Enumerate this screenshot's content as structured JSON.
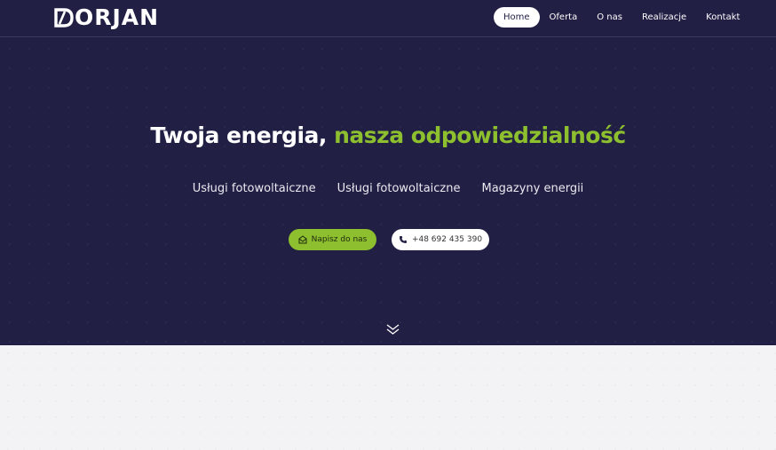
{
  "brand": {
    "logo_text": "ORJAN",
    "logo_icon": "stylized-d-bolt-icon"
  },
  "nav": {
    "items": [
      {
        "label": "Home",
        "active": true
      },
      {
        "label": "Oferta",
        "active": false
      },
      {
        "label": "O nas",
        "active": false
      },
      {
        "label": "Realizacje",
        "active": false
      },
      {
        "label": "Kontakt",
        "active": false
      }
    ]
  },
  "hero": {
    "headline_part1": "Twoja energia, ",
    "headline_part2": "nasza odpowiedzialność",
    "services": [
      "Usługi fotowoltaiczne",
      "Usługi fotowoltaiczne",
      "Magazyny energii"
    ],
    "cta_primary": {
      "label": "Napisz do nas",
      "icon": "envelope-open-icon"
    },
    "cta_secondary": {
      "label": "+48 692 435 390",
      "icon": "phone-icon"
    },
    "scroll_icon": "double-chevron-down-icon"
  },
  "colors": {
    "hero_bg": "#211f44",
    "accent": "#8dbf2e",
    "page_bg": "#f3f3f5"
  }
}
